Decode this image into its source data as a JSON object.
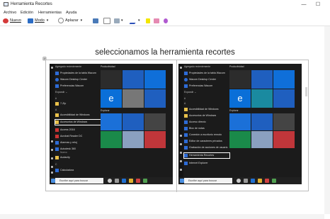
{
  "window": {
    "title": "Herramienta Recortes",
    "minimize": "—",
    "maximize": "☐"
  },
  "menu": [
    "Archivo",
    "Edición",
    "Herramientas",
    "Ayuda"
  ],
  "toolbar": {
    "new_label": "Nuevo",
    "mode_label": "Modo",
    "delay_label": "Aplazar"
  },
  "document": {
    "heading": "seleccionamos la herramienta recortes"
  },
  "left_menu": {
    "items": [
      "Agregado recientemente",
      "Propiedades de la tabla Wacom",
      "Wacom Desktop Center",
      "Preferencias Wacom",
      "Expandir ⌄",
      "#",
      "7-Zip",
      "A",
      "Accesibilidad de Windows",
      "Accesorios de Windows",
      "Access 2016",
      "Acrobat Reader DC",
      "Alarmas y reloj",
      "Autodesk 360",
      "Nuevo",
      "Audacity",
      "C",
      "Calculadora"
    ],
    "tile_header1": "Productividad",
    "tile_header2": "Explorar",
    "tiles": [
      "Office",
      "Todo el correo en una sola lugar",
      "Microsoft Edge",
      "Microsoft Store",
      "Muy nublado 27° 29° 21°",
      "Sólo Verano Fiestas",
      "Entretenimiento"
    ],
    "search_placeholder": "Escribe aquí para buscar"
  },
  "right_menu": {
    "items": [
      "Agregado recientemente",
      "Propiedades de la tabla Wacom",
      "Wacom Desktop Center",
      "Preferencias Wacom",
      "Expandir ⌄",
      "#",
      "A",
      "Accesibilidad de Windows",
      "Accesorios de Windows",
      "Acceso directo",
      "Bloc de notas",
      "Conexión a escritorio remoto",
      "Editor de caracteres privados",
      "Grabación de acciones de usuario",
      "Herramienta Recortes",
      "Internet Explorer"
    ],
    "tile_header1": "Productividad",
    "tile_header2": "Explorar",
    "tiles": [
      "Microsoft Edge",
      "Microsoft Store",
      "Muy nublado 27°",
      "Entretenimiento"
    ],
    "search_placeholder": "Escribe aquí para buscar"
  }
}
